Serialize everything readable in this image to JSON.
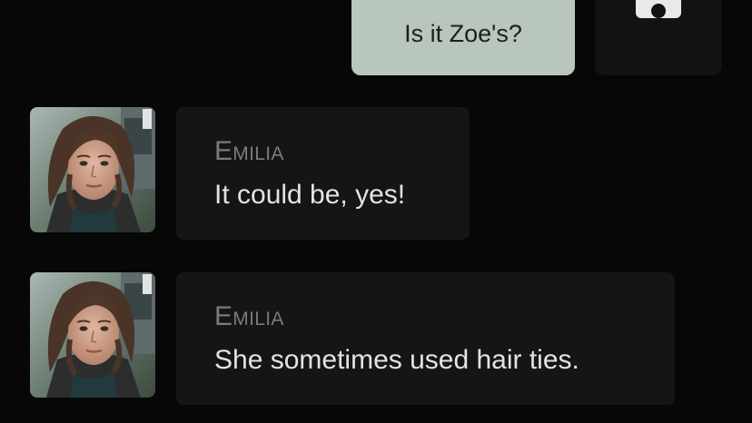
{
  "outgoing": {
    "text": "Is it Zoe's?",
    "bubble_color": "#b9c6bb",
    "avatar_icon": "camera-icon"
  },
  "incoming": [
    {
      "sender": "Emilia",
      "text": "It could be, yes!",
      "avatar": "emilia-portrait"
    },
    {
      "sender": "Emilia",
      "text": "She sometimes used hair ties.",
      "avatar": "emilia-portrait"
    }
  ],
  "colors": {
    "background": "#070707",
    "incoming_bubble": "#151515",
    "sender_name": "#7b7b7b",
    "message_text": "#e3e3e3"
  }
}
